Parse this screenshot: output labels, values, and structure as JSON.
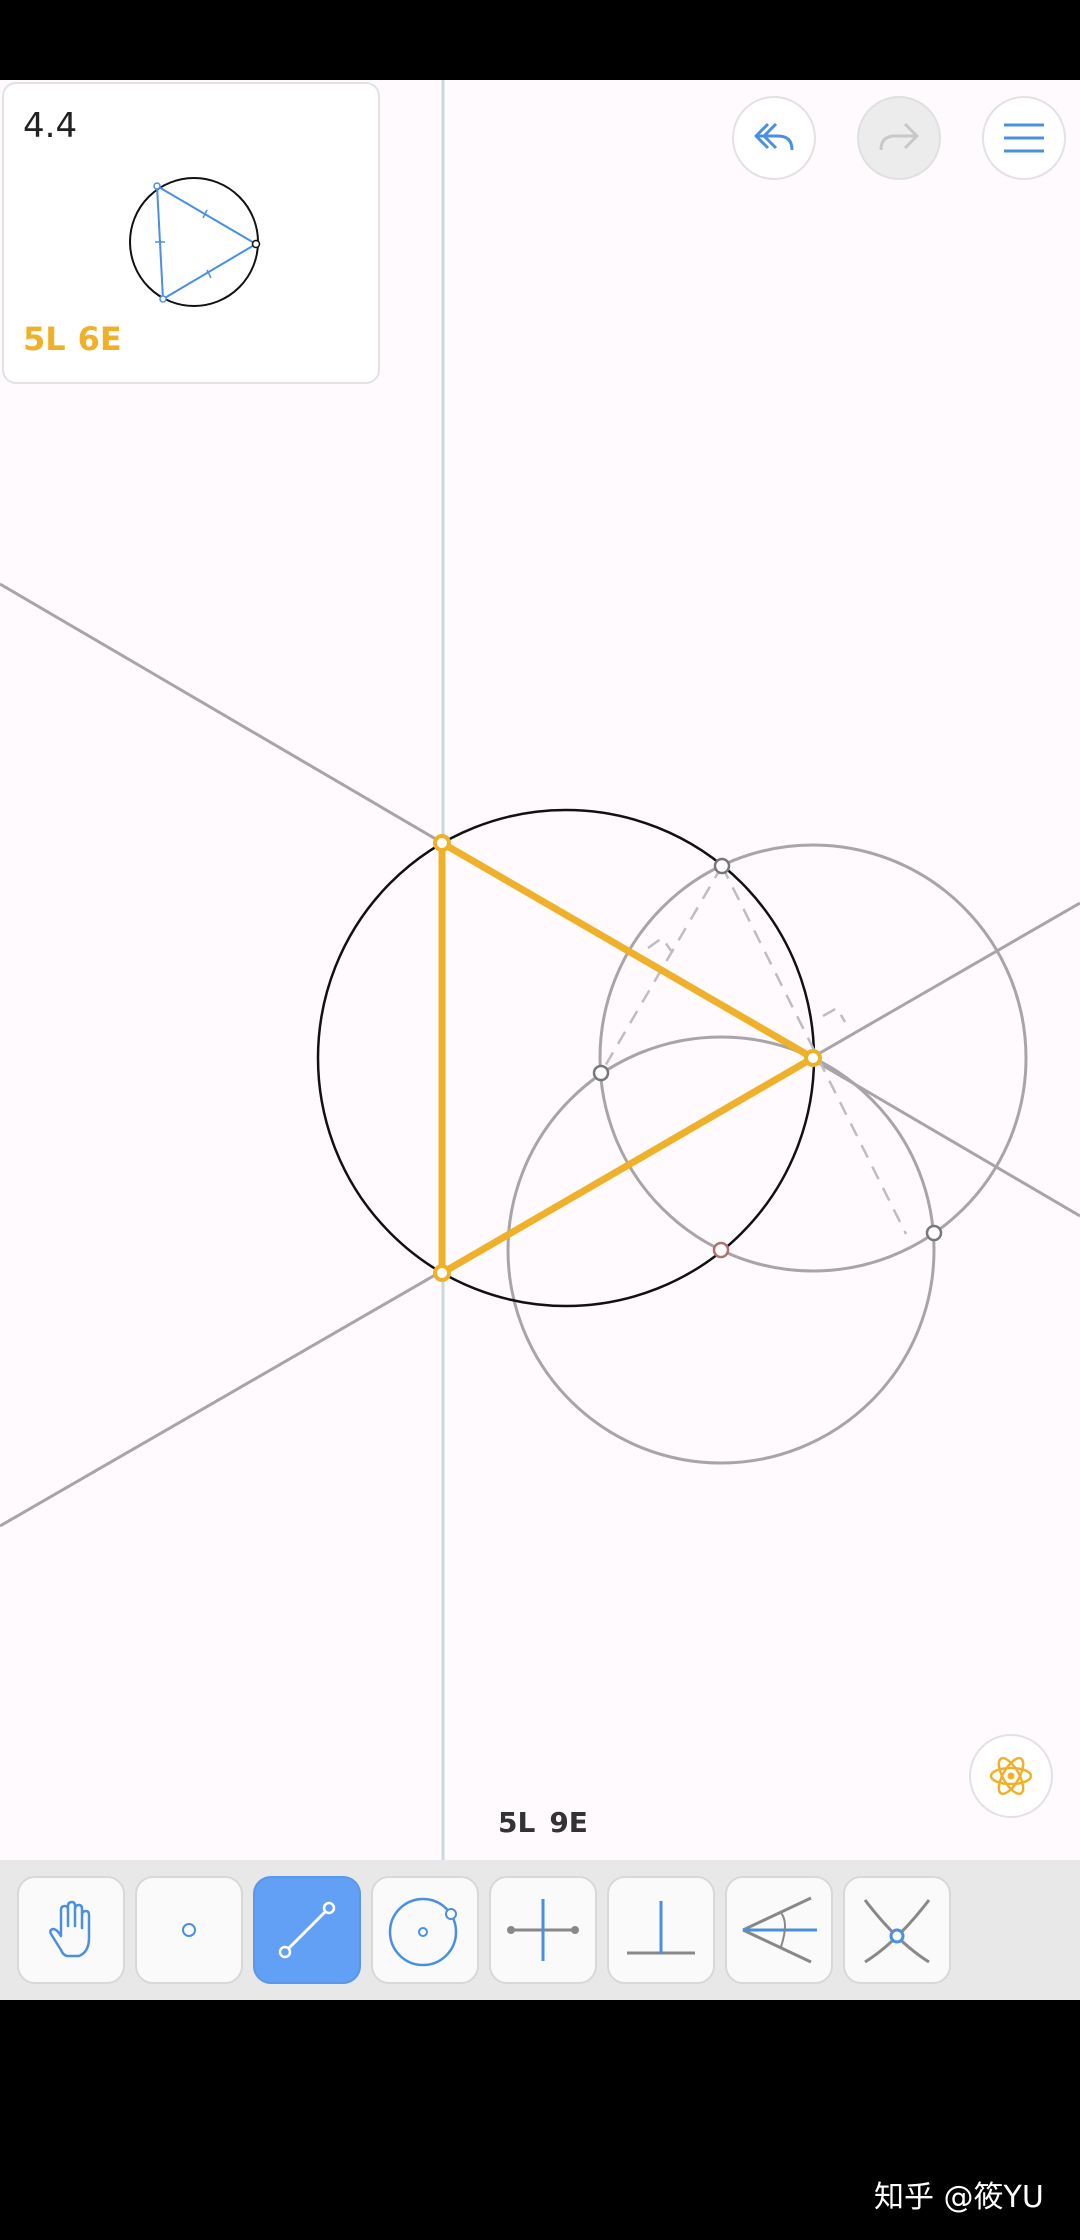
{
  "level": {
    "number": "4.4",
    "goal_lines": "5L",
    "goal_euclid": "6E"
  },
  "progress": {
    "lines": "5L",
    "euclid": "9E"
  },
  "toolbar": {
    "tools": [
      {
        "name": "move-tool",
        "icon": "hand-icon",
        "active": false
      },
      {
        "name": "point-tool",
        "icon": "point-icon",
        "active": false
      },
      {
        "name": "line-tool",
        "icon": "line-segment-icon",
        "active": true
      },
      {
        "name": "circle-tool",
        "icon": "circle-icon",
        "active": false
      },
      {
        "name": "perpendicular-bisector-tool",
        "icon": "perpendicular-bisector-icon",
        "active": false
      },
      {
        "name": "perpendicular-tool",
        "icon": "perpendicular-icon",
        "active": false
      },
      {
        "name": "angle-bisector-tool",
        "icon": "angle-bisector-icon",
        "active": false
      },
      {
        "name": "intersect-tool",
        "icon": "intersect-icon",
        "active": false
      }
    ]
  },
  "buttons": {
    "undo": "undo-icon",
    "redo": "redo-icon",
    "menu": "menu-icon",
    "hint": "atom-icon"
  },
  "colors": {
    "accent": "#f0b12a",
    "tool_blue": "#62a0f5",
    "construction_gray": "#a8a4a8",
    "icon_blue": "#4a90e2"
  },
  "watermark": "知乎 @筱YU"
}
